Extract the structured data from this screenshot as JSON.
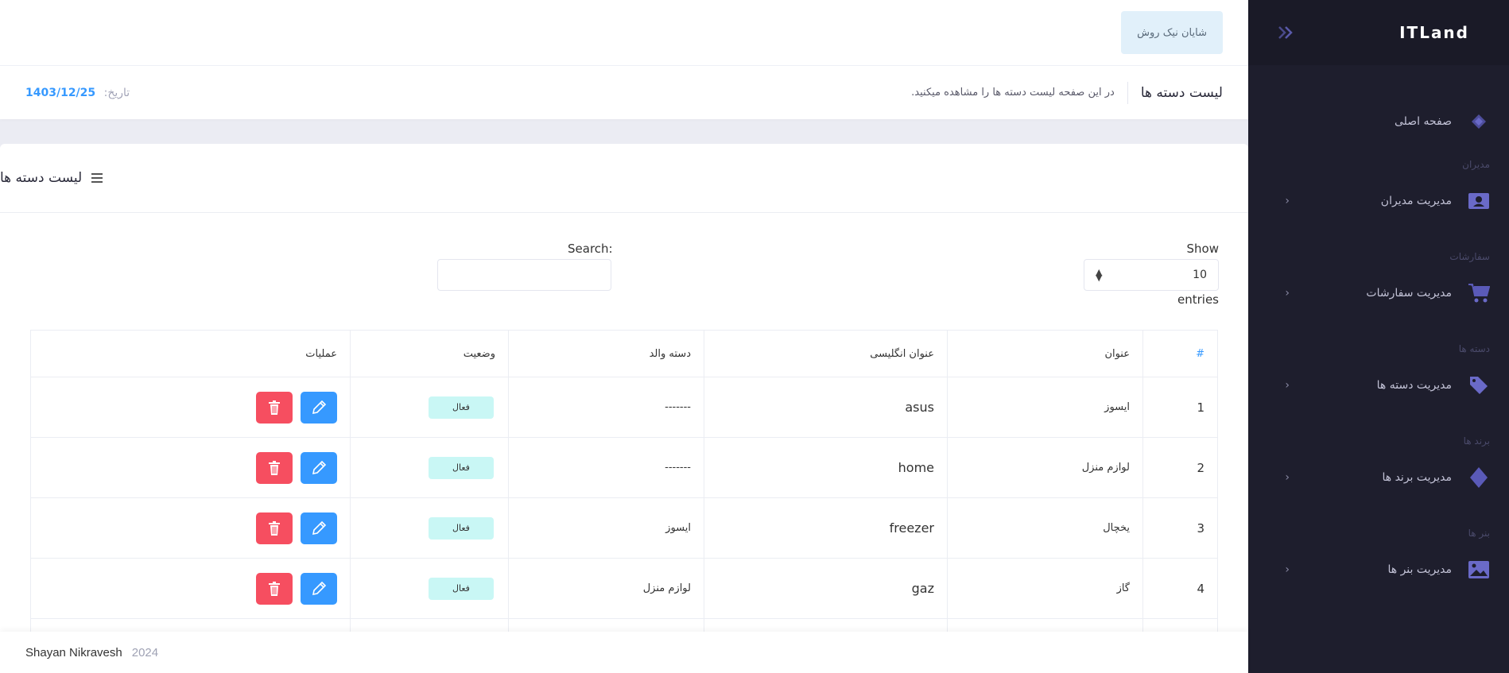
{
  "sidebar": {
    "brand": "ITLand",
    "items": [
      {
        "label": "صفحه اصلی"
      },
      {
        "section": "مدیران",
        "label": "مدیریت مدیران"
      },
      {
        "section": "سفارشات",
        "label": "مدیریت سفارشات"
      },
      {
        "section": "دسته ها",
        "label": "مدیریت دسته ها"
      },
      {
        "section": "برند ها",
        "label": "مدیریت برند ها"
      },
      {
        "section": "بنر ها",
        "label": "مدیریت بنر ها"
      }
    ]
  },
  "topbar": {
    "user": "شایان نیک روش"
  },
  "subheader": {
    "title": "لیست دسته ها",
    "description": "در این صفحه لیست دسته ها را مشاهده میکنید.",
    "date_label": "تاریخ:",
    "date_value": "1403/12/25"
  },
  "card": {
    "title": "لیست دسته ها",
    "show_label": "Show",
    "entries_value": "10",
    "entries_label": "entries",
    "search_label": "Search:",
    "search_placeholder": ""
  },
  "table": {
    "headers": [
      "#",
      "عنوان",
      "عنوان انگلیسی",
      "دسته والد",
      "وضعیت",
      "عملیات"
    ],
    "rows": [
      {
        "id": "1",
        "title": "ایسوز",
        "title_en": "asus",
        "parent": "-------",
        "status": "فعال"
      },
      {
        "id": "2",
        "title": "لوازم منزل",
        "title_en": "home",
        "parent": "-------",
        "status": "فعال"
      },
      {
        "id": "3",
        "title": "یخچال",
        "title_en": "freezer",
        "parent": "ایسوز",
        "status": "فعال"
      },
      {
        "id": "4",
        "title": "گاز",
        "title_en": "gaz",
        "parent": "لوازم منزل",
        "status": "فعال"
      }
    ]
  },
  "footer": {
    "year": "2024",
    "author": "Shayan Nikravesh"
  },
  "colors": {
    "sidebar_bg": "#1e1e2d",
    "primary": "#3699ff",
    "danger": "#f64e60",
    "success_light": "#c9f7f5"
  }
}
